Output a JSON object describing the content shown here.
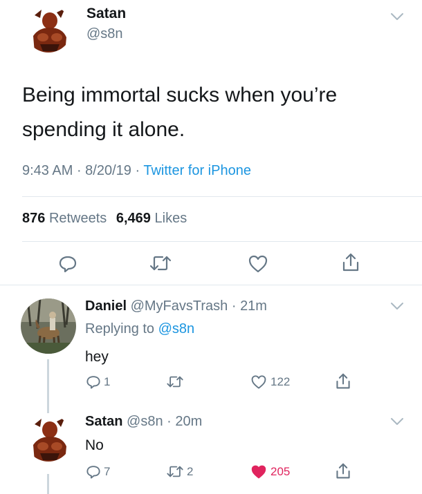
{
  "main_tweet": {
    "author_name": "Satan",
    "author_handle": "@s8n",
    "text_line1": "Being immortal sucks when you’re",
    "text_line2": "spending it alone.",
    "time": "9:43 AM",
    "date": "8/20/19",
    "source": "Twitter for iPhone",
    "retweets_count": "876",
    "retweets_label": "Retweets",
    "likes_count": "6,469",
    "likes_label": "Likes"
  },
  "reply1": {
    "author_name": "Daniel",
    "author_handle": "@MyFavsTrash",
    "age": "21m",
    "replying_prefix": "Replying to",
    "replying_to": "@s8n",
    "text": "hey",
    "reply_count": "1",
    "retweet_count": "",
    "like_count": "122"
  },
  "reply2": {
    "author_name": "Satan",
    "author_handle": "@s8n",
    "age": "20m",
    "text": "No",
    "reply_count": "7",
    "retweet_count": "2",
    "like_count": "205"
  },
  "colors": {
    "text": "#14171a",
    "secondary": "#657786",
    "link": "#1b95e0",
    "like_active": "#e0245e",
    "divider": "#e1e8ed"
  },
  "icons": [
    "chevron-down-icon",
    "reply-icon",
    "retweet-icon",
    "heart-icon",
    "share-icon"
  ]
}
